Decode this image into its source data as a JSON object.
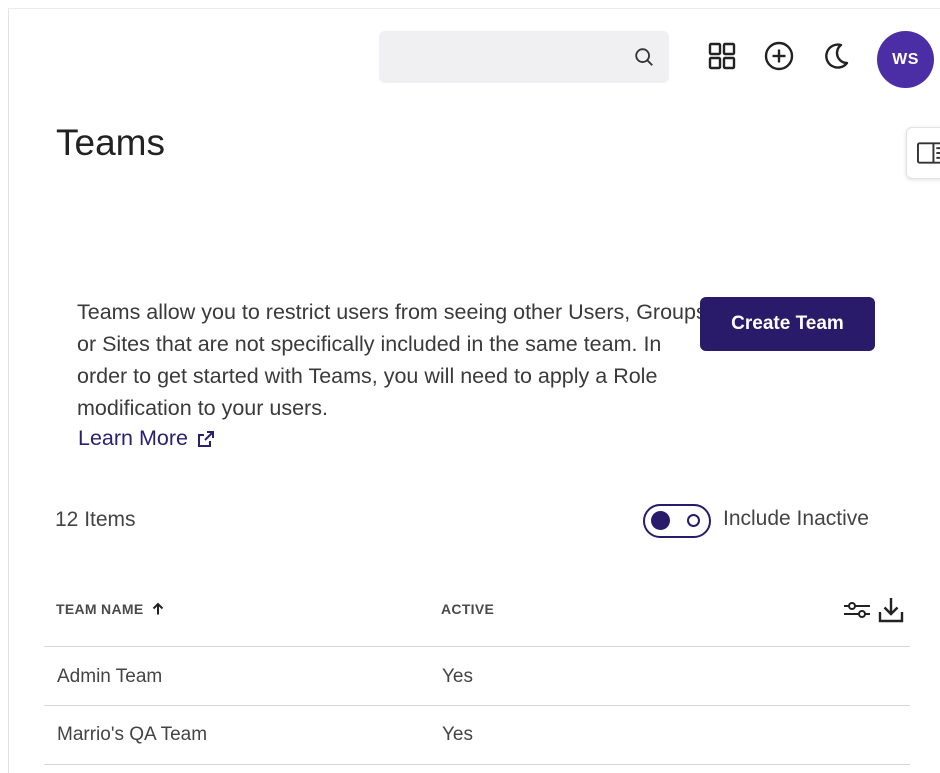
{
  "header": {
    "search": {
      "placeholder": "",
      "value": ""
    },
    "avatar_initials": "WS"
  },
  "page": {
    "title": "Teams",
    "intro": "Teams allow you to restrict users from seeing other Users, Groups or Sites that are not specifically included in the same team. In order to get started with Teams, you will need to apply a Role modification to your users.",
    "learn_more": "Learn More",
    "create_button": "Create Team"
  },
  "list": {
    "count_label": "12 Items",
    "include_inactive_label": "Include Inactive",
    "include_inactive_on": true
  },
  "table": {
    "columns": [
      {
        "label": "TEAM NAME",
        "sort": "ascending"
      },
      {
        "label": "ACTIVE"
      }
    ],
    "rows": [
      {
        "name": "Admin Team",
        "active": "Yes"
      },
      {
        "name": "Marrio's QA Team",
        "active": "Yes"
      }
    ]
  },
  "colors": {
    "accent": "#2a1a6a",
    "avatar": "#4b2ea6",
    "link": "#2b1f6e"
  },
  "icons": {
    "search": "search-icon",
    "apps": "apps-grid-icon",
    "add": "add-circle-icon",
    "theme": "moon-icon",
    "panel": "side-panel-icon",
    "external": "external-link-icon",
    "sort": "arrow-up-icon",
    "columns": "column-settings-icon",
    "export": "download-icon"
  }
}
